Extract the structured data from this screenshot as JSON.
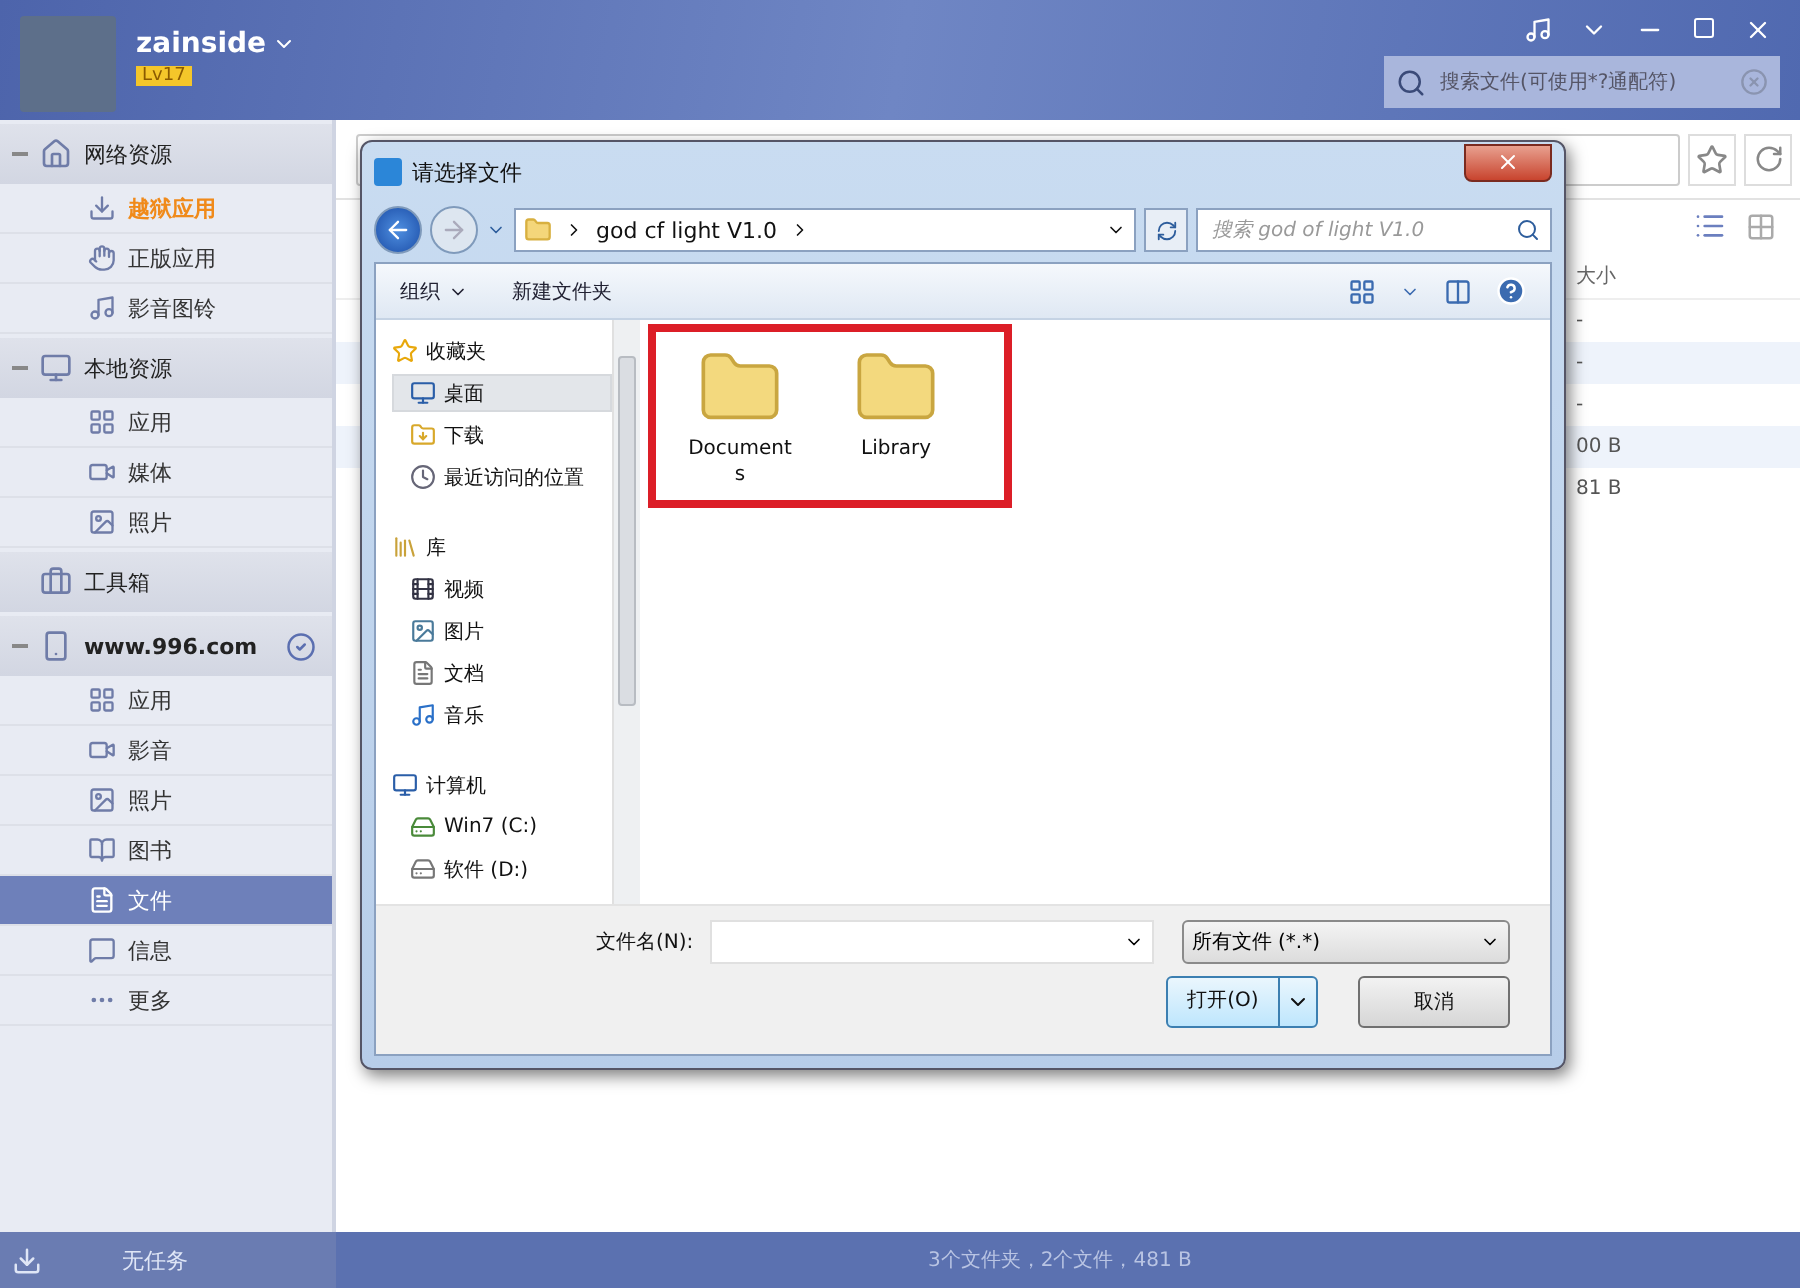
{
  "user": {
    "name": "zainside",
    "level": "Lv17"
  },
  "search": {
    "placeholder": "搜索文件(可使用*?通配符)"
  },
  "sidebar": {
    "groups": [
      {
        "label": "网络资源",
        "kind": "network",
        "expanded": true,
        "items": [
          {
            "label": "越狱应用",
            "kind": "jailbreak",
            "selected": false,
            "featured": true
          },
          {
            "label": "正版应用",
            "kind": "official",
            "selected": false,
            "featured": false
          },
          {
            "label": "影音图铃",
            "kind": "ringtone",
            "selected": false,
            "featured": false
          }
        ]
      },
      {
        "label": "本地资源",
        "kind": "local",
        "expanded": true,
        "items": [
          {
            "label": "应用",
            "kind": "apps",
            "selected": false,
            "featured": false
          },
          {
            "label": "媒体",
            "kind": "media",
            "selected": false,
            "featured": false
          },
          {
            "label": "照片",
            "kind": "photos",
            "selected": false,
            "featured": false
          }
        ]
      },
      {
        "label": "工具箱",
        "kind": "toolbox"
      },
      {
        "label": "www.996.com",
        "kind": "device",
        "expanded": true,
        "connected": true,
        "items": [
          {
            "label": "应用",
            "kind": "apps",
            "selected": false,
            "featured": false
          },
          {
            "label": "影音",
            "kind": "media",
            "selected": false,
            "featured": false
          },
          {
            "label": "照片",
            "kind": "photos",
            "selected": false,
            "featured": false
          },
          {
            "label": "图书",
            "kind": "books",
            "selected": false,
            "featured": false
          },
          {
            "label": "文件",
            "kind": "files",
            "selected": true,
            "featured": false
          },
          {
            "label": "信息",
            "kind": "messages",
            "selected": false,
            "featured": false
          },
          {
            "label": "更多",
            "kind": "more",
            "selected": false,
            "featured": false
          }
        ]
      }
    ]
  },
  "content": {
    "columns": [
      {
        "label": "大小"
      }
    ],
    "rows": [
      {
        "size": "-"
      },
      {
        "size": "-"
      },
      {
        "size": "-"
      },
      {
        "size": "00 B"
      },
      {
        "size": "81 B"
      }
    ]
  },
  "status_bar": {
    "tasks": "无任务",
    "summary": "3个文件夹，2个文件，481 B"
  },
  "dialog": {
    "title": "请选择文件",
    "path": [
      "god cf light V1.0"
    ],
    "search_placeholder": "搜索 god of light V1.0",
    "toolbar": [
      {
        "label": "组织",
        "dropdown": true
      },
      {
        "label": "新建文件夹",
        "dropdown": false
      }
    ],
    "nav": [
      {
        "label": "收藏夹",
        "kind": "favorites",
        "children": [
          {
            "label": "桌面",
            "kind": "desktop",
            "selected": true
          },
          {
            "label": "下载",
            "kind": "downloads",
            "selected": false
          },
          {
            "label": "最近访问的位置",
            "kind": "recent",
            "selected": false
          }
        ]
      },
      {
        "label": "库",
        "kind": "library",
        "children": [
          {
            "label": "视频",
            "kind": "videos",
            "selected": false
          },
          {
            "label": "图片",
            "kind": "pictures",
            "selected": false
          },
          {
            "label": "文档",
            "kind": "documents",
            "selected": false
          },
          {
            "label": "音乐",
            "kind": "music",
            "selected": false
          }
        ]
      },
      {
        "label": "计算机",
        "kind": "computer",
        "children": [
          {
            "label": "Win7 (C:)",
            "kind": "system-drive",
            "selected": false
          },
          {
            "label": "软件 (D:)",
            "kind": "drive",
            "selected": false
          }
        ]
      }
    ],
    "folders": [
      {
        "name": "Documents"
      },
      {
        "name": "Library"
      }
    ],
    "highlighted": true,
    "filename_label": "文件名(N):",
    "filter": "所有文件 (*.*)",
    "open_button": "打开(O)",
    "cancel_button": "取消"
  }
}
